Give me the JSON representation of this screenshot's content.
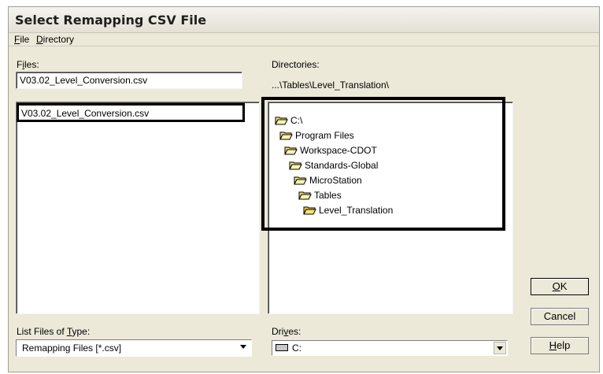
{
  "window": {
    "title": "Select Remapping CSV File"
  },
  "menu": [
    {
      "label_u": "F",
      "label_rest": "ile"
    },
    {
      "label_u": "D",
      "label_rest": "irectory"
    }
  ],
  "files": {
    "label_pre": "F",
    "label_u": "i",
    "label_post": "les:",
    "input_value": "V03.02_Level_Conversion.csv",
    "items": [
      "V03.02_Level_Conversion.csv"
    ]
  },
  "directories": {
    "label": "Directories:",
    "path": "...\\Tables\\Level_Translation\\",
    "tree": [
      "C:\\",
      "Program Files",
      "Workspace-CDOT",
      "Standards-Global",
      "MicroStation",
      "Tables",
      "Level_Translation"
    ]
  },
  "filetype": {
    "label_pre": "List Files of ",
    "label_u": "T",
    "label_post": "ype:",
    "value": "Remapping Files [*.csv]"
  },
  "drives": {
    "label_pre": "Dri",
    "label_u": "v",
    "label_post": "es:",
    "value": "C:"
  },
  "buttons": {
    "ok_u": "O",
    "ok_rest": "K",
    "cancel": "Cancel",
    "help_u": "H",
    "help_rest": "elp"
  },
  "colors": {
    "highlight_border": "#000000",
    "folder_fill": "#f7e27a"
  }
}
